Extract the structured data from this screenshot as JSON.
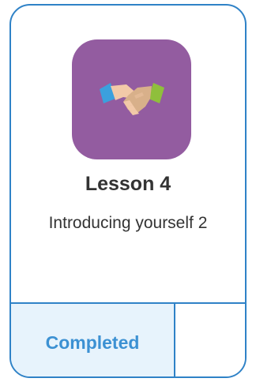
{
  "lesson_card": {
    "icon": "handshake-icon",
    "title": "Lesson 4",
    "subtitle": "Introducing yourself 2",
    "status": "Completed",
    "colors": {
      "border": "#2f82c7",
      "icon_tile": "#935ca0",
      "status_background": "#e7f3fc",
      "status_text": "#3c91d3"
    }
  }
}
